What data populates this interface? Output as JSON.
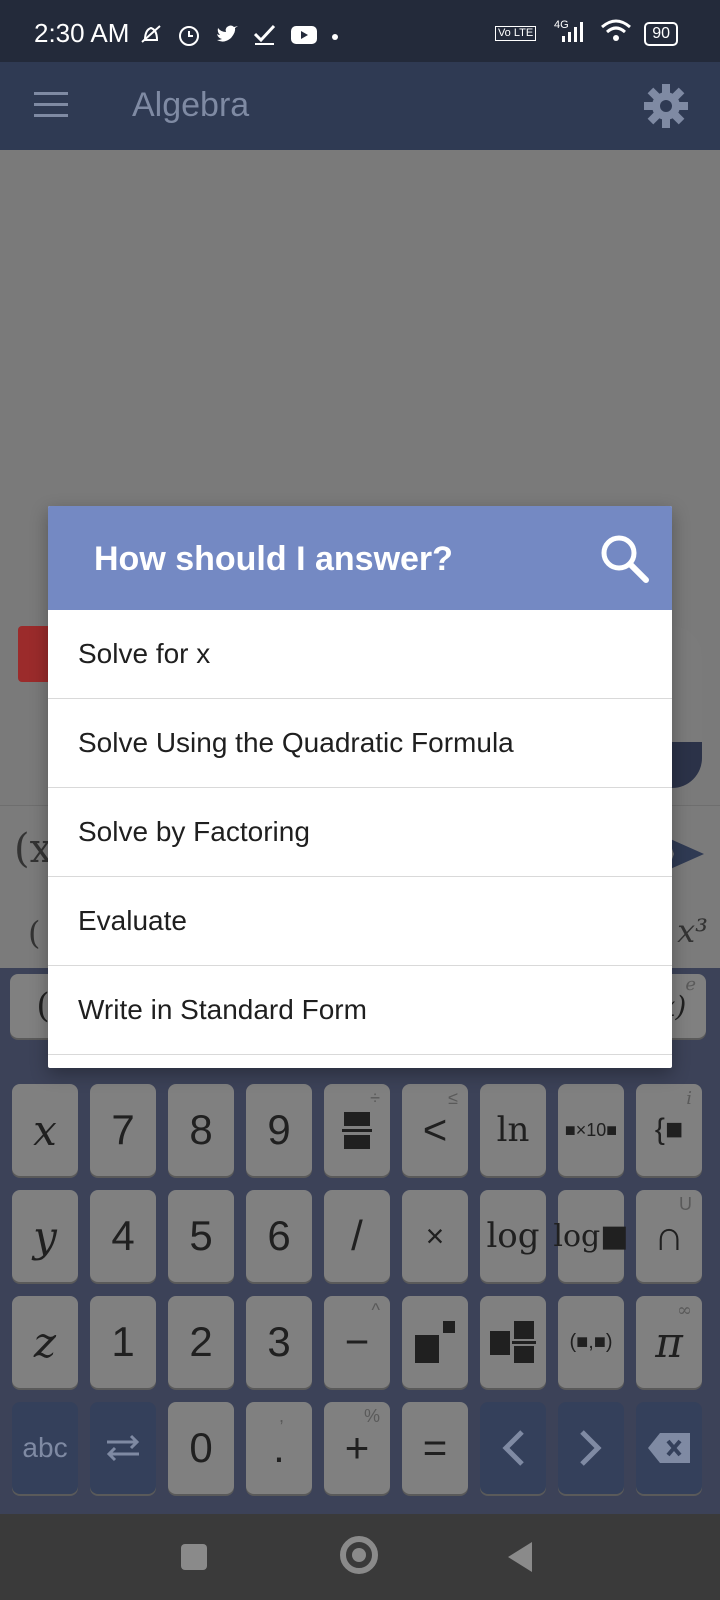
{
  "status": {
    "time": "2:30 AM",
    "battery": "90",
    "network": "4G",
    "volte": "Vo LTE"
  },
  "appbar": {
    "title": "Algebra"
  },
  "dialog": {
    "title": "How should I answer?",
    "options": [
      "Solve for x",
      "Solve Using the Quadratic Formula",
      "Solve by Factoring",
      "Evaluate",
      "Write in Standard Form"
    ]
  },
  "keyboard": {
    "row1": [
      "x",
      "7",
      "8",
      "9",
      "÷",
      "<",
      "ln",
      "■×10■",
      "{■"
    ],
    "row2": [
      "y",
      "4",
      "5",
      "6",
      "/",
      "×",
      "log",
      "log■",
      "∩"
    ],
    "row3": [
      "z",
      "1",
      "2",
      "3",
      "−",
      "■²",
      "■/■",
      "(■,■)",
      "π"
    ],
    "row4": [
      "abc",
      "⇆",
      "0",
      ".",
      "+",
      "=",
      "<",
      ">",
      "⌫"
    ],
    "super": {
      "div": "÷",
      "le": "≤",
      "i": "i",
      "U": "U",
      "pow": "^",
      "inf": "∞",
      "percent": "%",
      "comma": ","
    }
  },
  "background": {
    "input_fragment": "(x",
    "suggest_left": "(",
    "suggest_right": "x³",
    "paren_row_left": "(",
    "paren_row_right": "x)",
    "e_label": "e"
  }
}
